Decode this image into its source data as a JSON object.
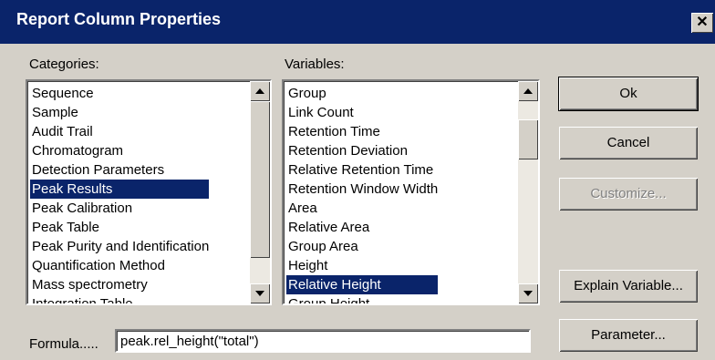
{
  "dialog": {
    "title": "Report Column Properties",
    "close_glyph": "✕"
  },
  "categories": {
    "label": "Categories:",
    "items": [
      {
        "label": "Sequence"
      },
      {
        "label": "Sample"
      },
      {
        "label": "Audit Trail"
      },
      {
        "label": "Chromatogram"
      },
      {
        "label": "Detection Parameters"
      },
      {
        "label": "Peak Results"
      },
      {
        "label": "Peak Calibration"
      },
      {
        "label": "Peak Table"
      },
      {
        "label": "Peak Purity and Identification"
      },
      {
        "label": "Quantification Method"
      },
      {
        "label": "Mass spectrometry"
      },
      {
        "label": "Integration Table"
      }
    ],
    "selected_index": 5
  },
  "variables": {
    "label": "Variables:",
    "items": [
      {
        "label": "Group"
      },
      {
        "label": "Link Count"
      },
      {
        "label": "Retention Time"
      },
      {
        "label": "Retention Deviation"
      },
      {
        "label": "Relative Retention Time"
      },
      {
        "label": "Retention Window Width"
      },
      {
        "label": "Area"
      },
      {
        "label": "Relative Area"
      },
      {
        "label": "Group Area"
      },
      {
        "label": "Height"
      },
      {
        "label": "Relative Height"
      },
      {
        "label": "Group Height"
      }
    ],
    "selected_index": 10
  },
  "buttons": {
    "ok": "Ok",
    "cancel": "Cancel",
    "customize": "Customize...",
    "explain": "Explain Variable...",
    "parameter": "Parameter..."
  },
  "formula": {
    "label": "Formula.....",
    "value": "peak.rel_height(\"total\")"
  },
  "colors": {
    "selection": "#0a246a",
    "face": "#d4d0c8"
  }
}
